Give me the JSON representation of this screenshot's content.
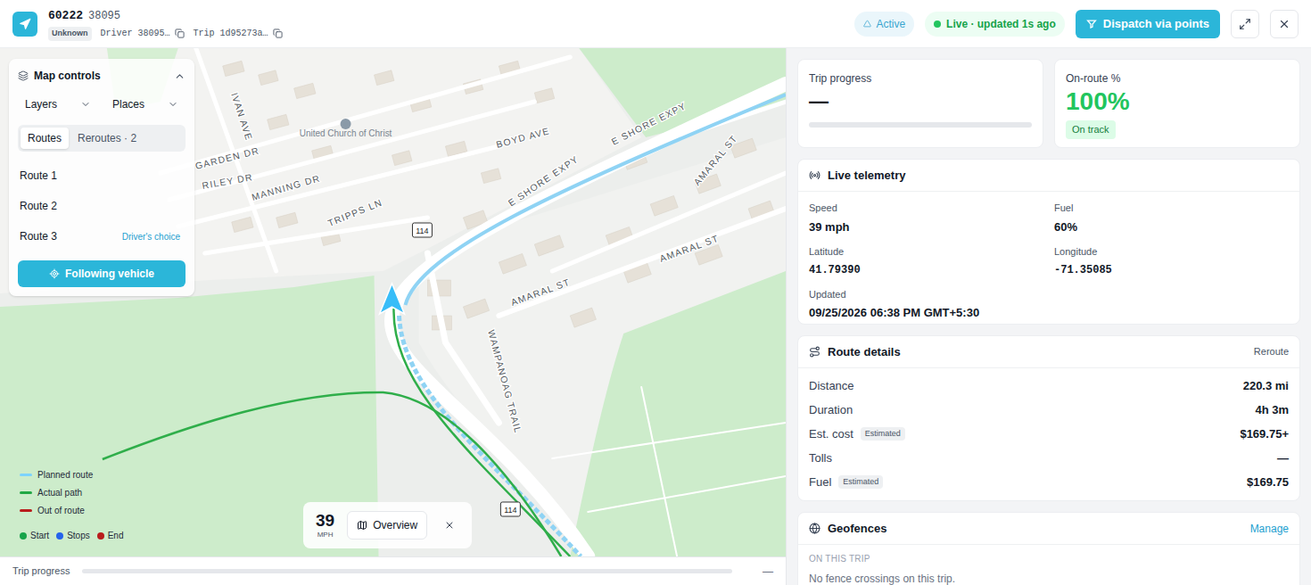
{
  "header": {
    "unit": "60222",
    "unit_id": "38095",
    "status_badge": "Unknown",
    "driver": "Driver 38095…",
    "trip": "Trip 1d95273a…",
    "active": "Active",
    "live": "Live · updated 1s ago",
    "dispatch_button": "Dispatch via points"
  },
  "map_controls": {
    "title": "Map controls",
    "expanded": true,
    "dropdowns": [
      "Layers",
      "Places"
    ],
    "tabs": [
      {
        "label": "Routes",
        "selected": true
      },
      {
        "label": "Reroutes · 2",
        "selected": false
      }
    ],
    "routes": [
      {
        "label": "Route 1"
      },
      {
        "label": "Route 2"
      },
      {
        "label": "Route 3",
        "badge": "Driver's choice"
      }
    ],
    "follow_button": {
      "label": "Following vehicle",
      "on": true
    }
  },
  "map": {
    "labels": [
      {
        "text": "IVAN AVE",
        "kind": "street"
      },
      {
        "text": "United Church of Christ",
        "kind": "place"
      },
      {
        "text": "BOYD AVE",
        "kind": "street"
      },
      {
        "text": "E SHORE EXPY",
        "kind": "street"
      },
      {
        "text": "AMARAL ST",
        "kind": "street"
      },
      {
        "text": "GARDEN DR",
        "kind": "street"
      },
      {
        "text": "RILEY DR",
        "kind": "street"
      },
      {
        "text": "MANNING DR",
        "kind": "street"
      },
      {
        "text": "E SHORE EXPY",
        "kind": "street"
      },
      {
        "text": "TRIPPS LN",
        "kind": "street"
      },
      {
        "text": "AMARAL ST",
        "kind": "street"
      },
      {
        "text": "AMARAL ST",
        "kind": "street"
      },
      {
        "text": "WAMPANOAG TRAIL",
        "kind": "street"
      }
    ],
    "road_shields": [
      "114",
      "114"
    ]
  },
  "legend": {
    "lines": [
      {
        "label": "Planned route",
        "color": "#7dd3fc"
      },
      {
        "label": "Actual path",
        "color": "#22a845"
      },
      {
        "label": "Out of route",
        "color": "#b91c1c"
      }
    ],
    "points": [
      {
        "label": "Start",
        "color": "#16a34a"
      },
      {
        "label": "Stops",
        "color": "#2563eb"
      },
      {
        "label": "End",
        "color": "#b91c1c"
      }
    ]
  },
  "speed_overlay": {
    "value": "39",
    "unit": "MPH",
    "overview_button": "Overview"
  },
  "bottom_progress": {
    "label": "Trip progress",
    "value": "—",
    "level": 0
  },
  "trip_progress": {
    "title": "Trip progress",
    "value": "—",
    "level": 0
  },
  "on_route": {
    "title": "On-route %",
    "value": "100%",
    "badge": "On track"
  },
  "telemetry": {
    "title": "Live telemetry",
    "fields": [
      {
        "label": "Speed",
        "value": "39 mph",
        "mono": false
      },
      {
        "label": "Fuel",
        "value": "60%",
        "mono": false
      },
      {
        "label": "Latitude",
        "value": "41.79390",
        "mono": true
      },
      {
        "label": "Longitude",
        "value": "-71.35085",
        "mono": true
      },
      {
        "label": "Updated",
        "value": "09/25/2026 06:38 PM GMT+5:30",
        "mono": false
      }
    ]
  },
  "route_details": {
    "title": "Route details",
    "action": "Reroute",
    "rows": [
      {
        "label": "Distance",
        "value": "220.3 mi"
      },
      {
        "label": "Duration",
        "value": "4h 3m"
      },
      {
        "label": "Est. cost",
        "tag": "Estimated",
        "value": "$169.75+"
      },
      {
        "label": "Tolls",
        "value": "—"
      },
      {
        "label": "Fuel",
        "tag": "Estimated",
        "value": "$169.75"
      }
    ]
  },
  "geofences": {
    "title": "Geofences",
    "action": "Manage",
    "section": "ON THIS TRIP",
    "empty": "No fence crossings on this trip."
  }
}
